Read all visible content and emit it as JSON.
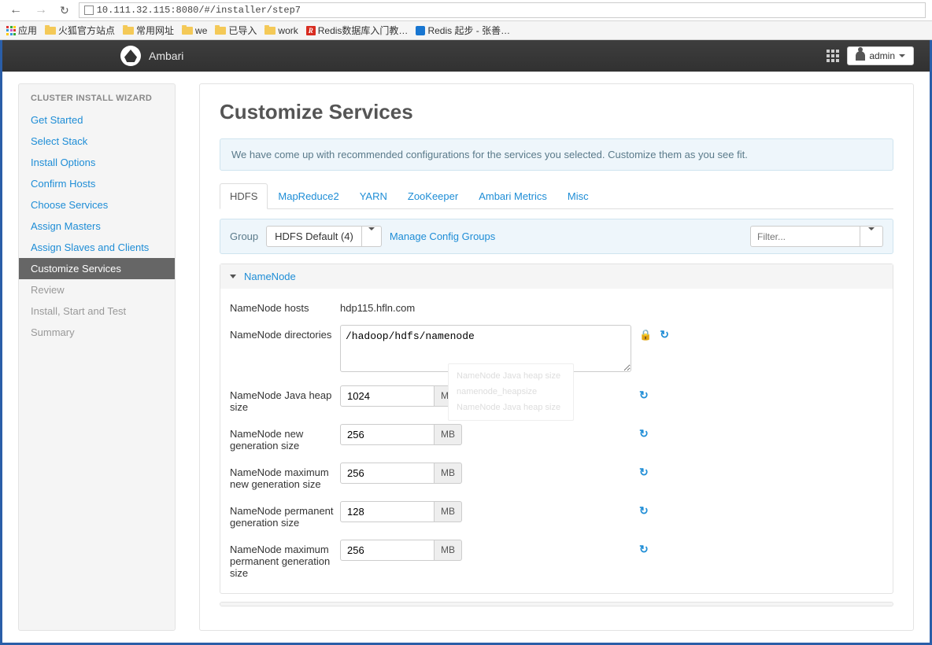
{
  "browser": {
    "url": "10.111.32.115:8080/#/installer/step7",
    "apps_label": "应用",
    "bookmarks": [
      {
        "label": "火狐官方站点",
        "icon": "folder"
      },
      {
        "label": "常用网址",
        "icon": "folder"
      },
      {
        "label": "we",
        "icon": "folder"
      },
      {
        "label": "已导入",
        "icon": "folder"
      },
      {
        "label": "work",
        "icon": "folder"
      },
      {
        "label": "Redis数据库入门教…",
        "icon": "redis"
      },
      {
        "label": "Redis 起步 - 张善…",
        "icon": "blue"
      }
    ]
  },
  "header": {
    "brand": "Ambari",
    "admin_label": "admin"
  },
  "sidebar": {
    "title": "CLUSTER INSTALL WIZARD",
    "items": [
      {
        "label": "Get Started",
        "state": "link"
      },
      {
        "label": "Select Stack",
        "state": "link"
      },
      {
        "label": "Install Options",
        "state": "link"
      },
      {
        "label": "Confirm Hosts",
        "state": "link"
      },
      {
        "label": "Choose Services",
        "state": "link"
      },
      {
        "label": "Assign Masters",
        "state": "link"
      },
      {
        "label": "Assign Slaves and Clients",
        "state": "link"
      },
      {
        "label": "Customize Services",
        "state": "active"
      },
      {
        "label": "Review",
        "state": "disabled"
      },
      {
        "label": "Install, Start and Test",
        "state": "disabled"
      },
      {
        "label": "Summary",
        "state": "disabled"
      }
    ]
  },
  "main": {
    "title": "Customize Services",
    "info": "We have come up with recommended configurations for the services you selected. Customize them as you see fit.",
    "tabs": [
      "HDFS",
      "MapReduce2",
      "YARN",
      "ZooKeeper",
      "Ambari Metrics",
      "Misc"
    ],
    "active_tab": "HDFS",
    "group_label": "Group",
    "group_value": "HDFS Default (4)",
    "manage_groups": "Manage Config Groups",
    "filter_placeholder": "Filter...",
    "section": {
      "title": "NameNode",
      "fields": {
        "hosts_label": "NameNode hosts",
        "hosts_value": "hdp115.hfln.com",
        "dirs_label": "NameNode directories",
        "dirs_value": "/hadoop/hdfs/namenode",
        "heap_label": "NameNode Java heap size",
        "heap_value": "1024",
        "newgen_label": "NameNode new generation size",
        "newgen_value": "256",
        "maxnewgen_label": "NameNode maximum new generation size",
        "maxnewgen_value": "256",
        "permgen_label": "NameNode permanent generation size",
        "permgen_value": "128",
        "maxpermgen_label": "NameNode maximum permanent generation size",
        "maxpermgen_value": "256",
        "unit": "MB"
      }
    },
    "tooltip": {
      "line1": "NameNode Java heap size",
      "line2": "namenode_heapsize",
      "line3": "NameNode Java heap size"
    }
  }
}
